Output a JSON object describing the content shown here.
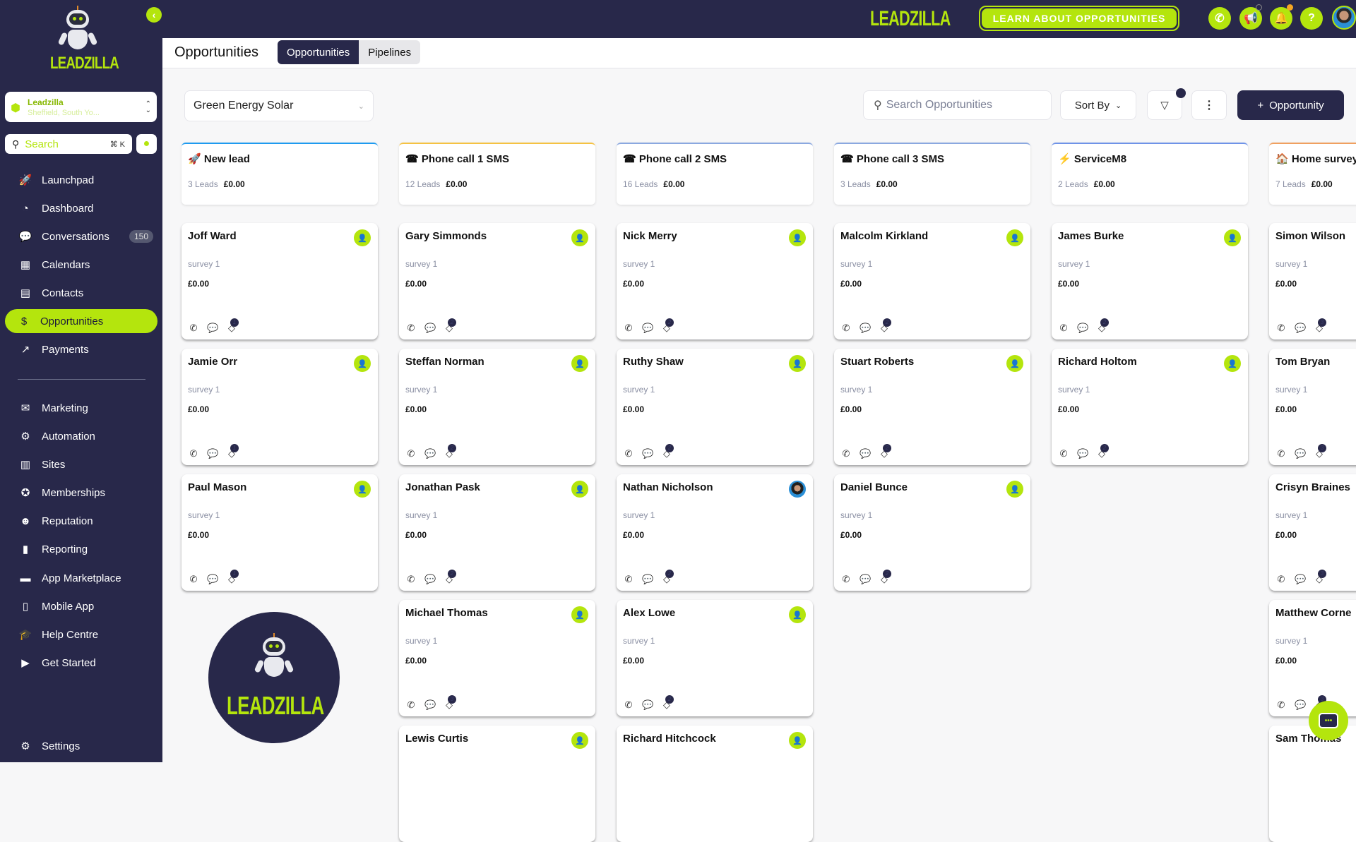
{
  "app": {
    "brand": "LEADZILLA",
    "collapse_icon": "chevron-left-icon"
  },
  "location": {
    "name": "Leadzilla",
    "address": "Sheffield, South Yo..."
  },
  "sidebar_search": {
    "placeholder": "Search",
    "shortcut": "⌘ K"
  },
  "sidebar": {
    "items": [
      {
        "label": "Launchpad",
        "icon": "rocket-icon",
        "glyph": "🚀"
      },
      {
        "label": "Dashboard",
        "icon": "gauge-icon",
        "glyph": "◔"
      },
      {
        "label": "Conversations",
        "icon": "chat-bubbles-icon",
        "glyph": "💬",
        "badge": "150"
      },
      {
        "label": "Calendars",
        "icon": "calendar-icon",
        "glyph": "▦"
      },
      {
        "label": "Contacts",
        "icon": "contact-card-icon",
        "glyph": "▤"
      },
      {
        "label": "Opportunities",
        "icon": "money-chat-icon",
        "glyph": "$",
        "active": true
      },
      {
        "label": "Payments",
        "icon": "payments-chart-icon",
        "glyph": "↗"
      },
      {
        "label": "Marketing",
        "icon": "mail-check-icon",
        "glyph": "✉"
      },
      {
        "label": "Automation",
        "icon": "webhook-icon",
        "glyph": "⚙"
      },
      {
        "label": "Sites",
        "icon": "newspaper-icon",
        "glyph": "▥"
      },
      {
        "label": "Memberships",
        "icon": "award-icon",
        "glyph": "✪"
      },
      {
        "label": "Reputation",
        "icon": "smiley-icon",
        "glyph": "☻"
      },
      {
        "label": "Reporting",
        "icon": "bar-chart-icon",
        "glyph": "▮"
      },
      {
        "label": "App Marketplace",
        "icon": "briefcase-icon",
        "glyph": "▬"
      },
      {
        "label": "Mobile App",
        "icon": "mobile-icon",
        "glyph": "▯"
      },
      {
        "label": "Help Centre",
        "icon": "graduation-cap-icon",
        "glyph": "🎓"
      },
      {
        "label": "Get Started",
        "icon": "play-square-icon",
        "glyph": "▶"
      },
      {
        "label": "Settings",
        "icon": "gear-icon",
        "glyph": "⚙"
      }
    ]
  },
  "topbar": {
    "learn_button": "LEARN ABOUT OPPORTUNITIES",
    "icons": [
      "phone-icon",
      "megaphone-icon",
      "bell-icon",
      "help-icon"
    ],
    "help_glyph": "?",
    "colors": {
      "accent": "#b4e50d",
      "navy": "#28284a",
      "notification": "#f5a623"
    }
  },
  "page": {
    "title": "Opportunities",
    "tabs": [
      {
        "label": "Opportunities",
        "active": true
      },
      {
        "label": "Pipelines",
        "active": false
      }
    ]
  },
  "toolbar": {
    "pipeline": "Green Energy Solar",
    "search_placeholder": "Search Opportunities",
    "sort_label": "Sort By",
    "add_label": "Opportunity"
  },
  "stages": [
    {
      "emoji": "🚀",
      "name": "New lead",
      "leads": "3 Leads",
      "value": "£0.00",
      "color": "#1e9bf0",
      "cards": [
        {
          "name": "Joff Ward",
          "survey": "survey 1",
          "value": "£0.00",
          "tags": "1"
        },
        {
          "name": "Jamie Orr",
          "survey": "survey 1",
          "value": "£0.00",
          "tags": "1"
        },
        {
          "name": "Paul Mason",
          "survey": "survey 1",
          "value": "£0.00",
          "tags": "1"
        }
      ]
    },
    {
      "emoji": "☎",
      "name": "Phone call 1 SMS",
      "leads": "12 Leads",
      "value": "£0.00",
      "color": "#f5c242",
      "cards": [
        {
          "name": "Gary Simmonds",
          "survey": "survey 1",
          "value": "£0.00",
          "tags": "2"
        },
        {
          "name": "Steffan Norman",
          "survey": "survey 1",
          "value": "£0.00",
          "tags": "2"
        },
        {
          "name": "Jonathan Pask",
          "survey": "survey 1",
          "value": "£0.00",
          "tags": "2"
        },
        {
          "name": "Michael Thomas",
          "survey": "survey 1",
          "value": "£0.00",
          "tags": "3"
        },
        {
          "name": "Lewis Curtis"
        }
      ]
    },
    {
      "emoji": "☎",
      "name": "Phone call 2 SMS",
      "leads": "16 Leads",
      "value": "£0.00",
      "color": "#8aa8e0",
      "cards": [
        {
          "name": "Nick Merry",
          "survey": "survey 1",
          "value": "£0.00",
          "tags": "2"
        },
        {
          "name": "Ruthy Shaw",
          "survey": "survey 1",
          "value": "£0.00",
          "tags": "2"
        },
        {
          "name": "Nathan Nicholson",
          "survey": "survey 1",
          "value": "£0.00",
          "tags": "2",
          "photo": true
        },
        {
          "name": "Alex Lowe",
          "survey": "survey 1",
          "value": "£0.00",
          "tags": "2"
        },
        {
          "name": "Richard Hitchcock"
        }
      ]
    },
    {
      "emoji": "☎",
      "name": "Phone call 3 SMS",
      "leads": "3 Leads",
      "value": "£0.00",
      "color": "#8aa8e0",
      "cards": [
        {
          "name": "Malcolm Kirkland",
          "survey": "survey 1",
          "value": "£0.00",
          "tags": "2"
        },
        {
          "name": "Stuart Roberts",
          "survey": "survey 1",
          "value": "£0.00",
          "tags": "2"
        },
        {
          "name": "Daniel Bunce",
          "survey": "survey 1",
          "value": "£0.00",
          "tags": "2"
        }
      ]
    },
    {
      "emoji": "⚡",
      "name": "ServiceM8",
      "leads": "2 Leads",
      "value": "£0.00",
      "color": "#6f93e8",
      "cards": [
        {
          "name": "James Burke",
          "survey": "survey 1",
          "value": "£0.00",
          "tags": "2"
        },
        {
          "name": "Richard Holtom",
          "survey": "survey 1",
          "value": "£0.00",
          "tags": "2"
        }
      ]
    },
    {
      "emoji": "🏠",
      "name": "Home survey",
      "leads": "7 Leads",
      "value": "£0.00",
      "color": "#f0a060",
      "cards": [
        {
          "name": "Simon Wilson",
          "survey": "survey 1",
          "value": "£0.00",
          "tags": "3"
        },
        {
          "name": "Tom Bryan",
          "survey": "survey 1",
          "value": "£0.00",
          "tags": "3"
        },
        {
          "name": "Crisyn Braines",
          "survey": "survey 1",
          "value": "£0.00",
          "tags": "3"
        },
        {
          "name": "Matthew Corne",
          "survey": "survey 1",
          "value": "£0.00",
          "tags": "3"
        },
        {
          "name": "Sam Thomas"
        }
      ]
    }
  ],
  "card_actions": [
    {
      "icon": "phone-call-icon",
      "glyph": "✆"
    },
    {
      "icon": "message-icon",
      "glyph": "💬"
    },
    {
      "icon": "tag-icon",
      "glyph": "◇"
    },
    {
      "icon": "note-icon",
      "glyph": "▤"
    },
    {
      "icon": "task-check-icon",
      "glyph": "☑"
    },
    {
      "icon": "calendar-add-icon",
      "glyph": "▣"
    }
  ],
  "assign_glyph": "👤",
  "chat_widget": {
    "glyph": "•••"
  }
}
